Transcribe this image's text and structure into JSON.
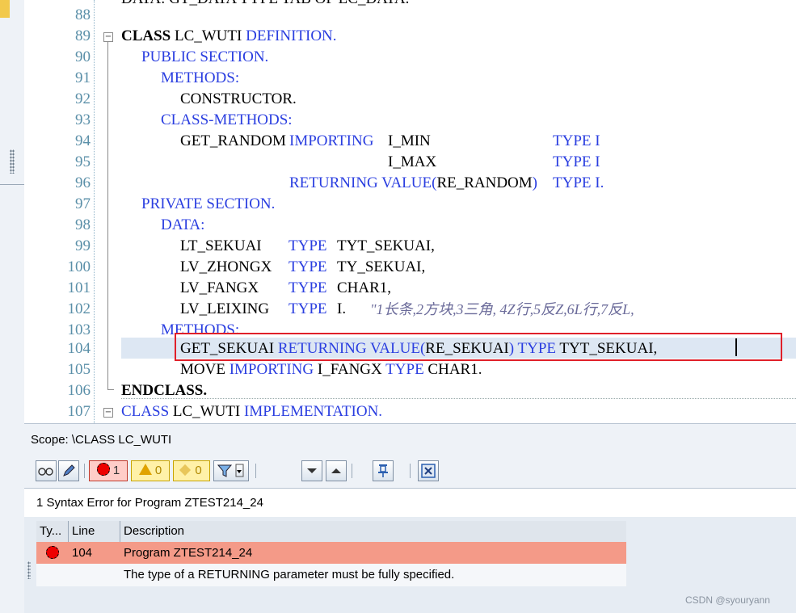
{
  "editor": {
    "partial_line": "DATA: GT_DATA TYPE TAB OF LC_DATA.",
    "lines": [
      {
        "num": "88"
      },
      {
        "num": "89"
      },
      {
        "num": "90"
      },
      {
        "num": "91"
      },
      {
        "num": "92"
      },
      {
        "num": "93"
      },
      {
        "num": "94"
      },
      {
        "num": "95"
      },
      {
        "num": "96"
      },
      {
        "num": "97"
      },
      {
        "num": "98"
      },
      {
        "num": "99"
      },
      {
        "num": "100"
      },
      {
        "num": "101"
      },
      {
        "num": "102"
      },
      {
        "num": "103"
      },
      {
        "num": "104"
      },
      {
        "num": "105"
      },
      {
        "num": "106"
      },
      {
        "num": "107"
      }
    ],
    "code": {
      "l89_kw": "CLASS",
      "l89_name": "LC_WUTI",
      "l89_def": "DEFINITION.",
      "l90": "PUBLIC SECTION.",
      "l91": "METHODS:",
      "l92": "CONSTRUCTOR.",
      "l93": "CLASS-METHODS:",
      "l94_a": "GET_RANDOM",
      "l94_b": "IMPORTING",
      "l94_c": "I_MIN",
      "l94_d": "TYPE I",
      "l95_c": "I_MAX",
      "l95_d": "TYPE I",
      "l96_a": "RETURNING VALUE(",
      "l96_b": "RE_RANDOM",
      "l96_c": ")",
      "l96_d": "TYPE I.",
      "l97": "PRIVATE SECTION.",
      "l98": "DATA:",
      "l99_a": "LT_SEKUAI",
      "l99_b": "TYPE",
      "l99_c": "TYT_SEKUAI,",
      "l100_a": "LV_ZHONGX",
      "l100_b": "TYPE",
      "l100_c": "TY_SEKUAI,",
      "l101_a": "LV_FANGX",
      "l101_b": "TYPE",
      "l101_c": "CHAR1,",
      "l102_a": "LV_LEIXING",
      "l102_b": "TYPE",
      "l102_c": "I.",
      "l102_cmt": "\"1长条,2方块,3三角, 4Z行,5反Z,6L行,7反L,",
      "l103": "METHODS:",
      "l104_a": "GET_SEKUAI",
      "l104_b": "RETURNING VALUE(",
      "l104_c": "RE_SEKUAI",
      "l104_d": ")",
      "l104_e": "TYPE",
      "l104_f": "TYT_SEKUAI,",
      "l105_a": "MOVE",
      "l105_b": "IMPORTING",
      "l105_c": "I_FANGX",
      "l105_d": "TYPE",
      "l105_e": "CHAR1.",
      "l106": "ENDCLASS.",
      "l107_kw": "CLASS",
      "l107_name": "LC_WUTI",
      "l107_impl": "IMPLEMENTATION."
    }
  },
  "scope": {
    "label": "Scope: \\CLASS LC_WUTI"
  },
  "toolbar": {
    "errors_count": "1",
    "warnings_count": "0",
    "infos_count": "0",
    "buttons": [
      "glasses-icon",
      "pencil-icon",
      "error-filter",
      "warning-filter",
      "info-filter",
      "filter-icon",
      "down-arrow-icon",
      "up-arrow-icon",
      "pin-icon",
      "close-icon"
    ]
  },
  "messages": {
    "title": "1 Syntax Error for Program ZTEST214_24",
    "columns": {
      "type": "Ty...",
      "line": "Line",
      "description": "Description"
    },
    "rows": [
      {
        "line": "104",
        "description": "Program ZTEST214_24"
      },
      {
        "line": "",
        "description": "The type of a RETURNING parameter must be fully specified."
      }
    ]
  },
  "watermark": "CSDN @syouryann",
  "colors": {
    "keyword": "#2a3ee0",
    "error_row": "#f49a88",
    "highlight_box": "#e0202a"
  }
}
